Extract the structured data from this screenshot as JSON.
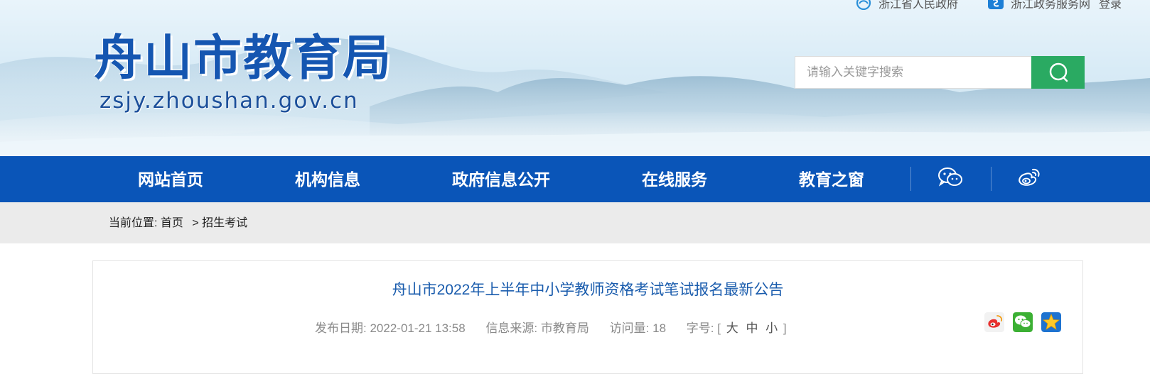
{
  "top_links": {
    "zj_gov": "浙江省人民政府",
    "zj_service": "浙江政务服务网",
    "login": "登录"
  },
  "logo": {
    "cn": "舟山市教育局",
    "domain": "zsjy.zhoushan.gov.cn"
  },
  "search": {
    "placeholder": "请输入关键字搜索"
  },
  "nav": {
    "items": [
      "网站首页",
      "机构信息",
      "政府信息公开",
      "在线服务",
      "教育之窗"
    ],
    "icons": [
      "wechat-icon",
      "weibo-icon"
    ]
  },
  "breadcrumb": {
    "prefix": "当前位置:",
    "home": "首页",
    "sep": ">",
    "current": "招生考试"
  },
  "article": {
    "title": "舟山市2022年上半年中小学教师资格考试笔试报名最新公告",
    "date_label": "发布日期:",
    "date": "2022-01-21 13:58",
    "source_label": "信息来源:",
    "source": "市教育局",
    "visits_label": "访问量:",
    "visits": "18",
    "fontsize_label": "字号:",
    "fontsize_open": "[",
    "fontsize_large": "大",
    "fontsize_medium": "中",
    "fontsize_small": "小",
    "fontsize_close": "]",
    "share_icons": [
      "weibo-share-icon",
      "wechat-share-icon",
      "favorite-star-icon"
    ]
  },
  "colors": {
    "nav_blue": "#0a55b8",
    "search_green": "#2aaa62",
    "title_blue": "#1a5cad",
    "logo_blue": "#1556b1"
  }
}
